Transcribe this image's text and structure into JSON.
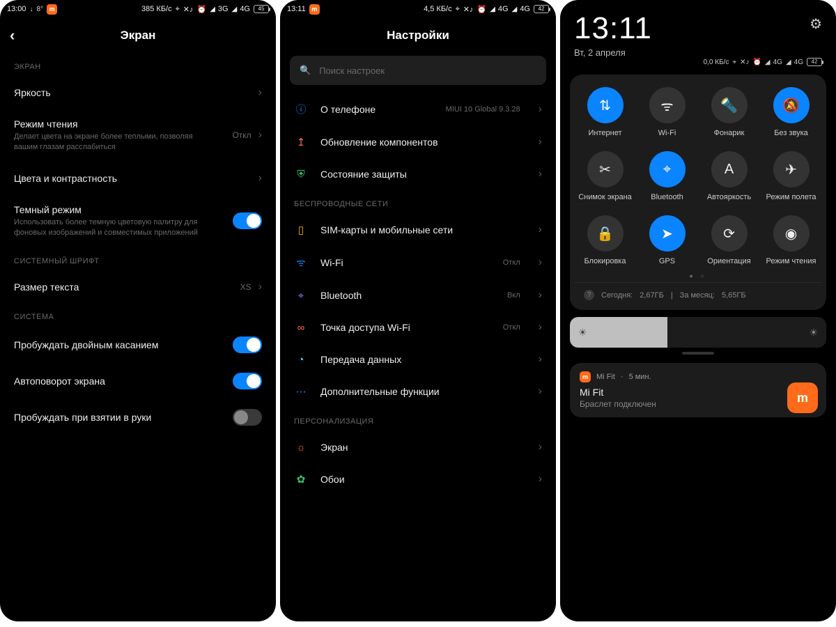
{
  "s1": {
    "status": {
      "time": "13:00",
      "dl": "↓",
      "temp": "8°",
      "speed": "385 КБ/с",
      "net1": "3G",
      "net2": "4G",
      "batt": "45"
    },
    "title": "Экран",
    "sec_screen": "ЭКРАН",
    "brightness": "Яркость",
    "reading": {
      "t": "Режим чтения",
      "s": "Делает цвета на экране более теплыми, позволяя вашим глазам расслабиться",
      "v": "Откл"
    },
    "colors": "Цвета и контрастность",
    "dark": {
      "t": "Темный режим",
      "s": "Использовать более темную цветовую палитру для фоновых изображений и совместимых приложений"
    },
    "sec_font": "СИСТЕМНЫЙ ШРИФТ",
    "textsize": {
      "t": "Размер текста",
      "v": "XS"
    },
    "sec_sys": "СИСТЕМА",
    "dtap": "Пробуждать двойным касанием",
    "autorotate": "Автоповорот экрана",
    "raise": "Пробуждать при взятии в руки"
  },
  "s2": {
    "status": {
      "time": "13:11",
      "speed": "4,5 КБ/с",
      "net1": "4G",
      "net2": "4G",
      "batt": "42"
    },
    "title": "Настройки",
    "search": "Поиск настроек",
    "about": {
      "t": "О телефоне",
      "v": "MIUI 10 Global 9.3.28"
    },
    "update": "Обновление компонентов",
    "security": "Состояние защиты",
    "sec_wireless": "БЕСПРОВОДНЫЕ СЕТИ",
    "sim": "SIM-карты и мобильные сети",
    "wifi": {
      "t": "Wi-Fi",
      "v": "Откл"
    },
    "bt": {
      "t": "Bluetooth",
      "v": "Вкл"
    },
    "hotspot": {
      "t": "Точка доступа Wi-Fi",
      "v": "Откл"
    },
    "data": "Передача данных",
    "more": "Дополнительные функции",
    "sec_pers": "ПЕРСОНАЛИЗАЦИЯ",
    "display": "Экран",
    "wallpaper": "Обои"
  },
  "s3": {
    "clock": "13:11",
    "date": "Вт, 2 апреля",
    "mini": {
      "speed": "0,0 КБ/с",
      "net1": "4G",
      "net2": "4G",
      "batt": "42"
    },
    "qs": {
      "internet": "Интернет",
      "wifi": "Wi-Fi",
      "torch": "Фонарик",
      "mute": "Без звука",
      "screenshot": "Снимок экрана",
      "bt": "Bluetooth",
      "autobright": "Автояркость",
      "airplane": "Режим полета",
      "lock": "Блокировка",
      "gps": "GPS",
      "orient": "Ориентация",
      "reading": "Режим чтения"
    },
    "usage": {
      "today_l": "Сегодня:",
      "today_v": "2,67ГБ",
      "sep": "|",
      "month_l": "За месяц:",
      "month_v": "5,65ГБ"
    },
    "notif": {
      "app": "Mi Fit",
      "time": "5 мин.",
      "title": "Mi Fit",
      "sub": "Браслет подключен"
    }
  }
}
